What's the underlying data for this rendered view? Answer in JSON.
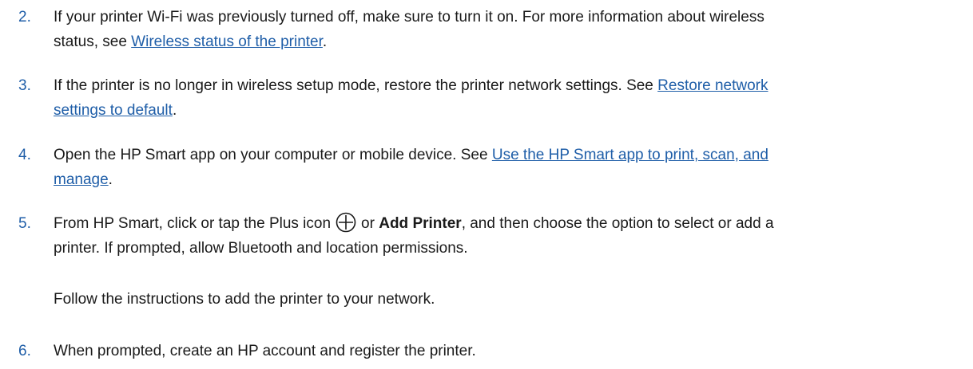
{
  "steps": [
    {
      "number": "2.",
      "line1": "If your printer Wi-Fi was previously turned off, make sure to turn it on. For more information about wireless",
      "line2_prefix": "status, see ",
      "line2_link": "Wireless status of the printer",
      "line2_suffix": "."
    },
    {
      "number": "3.",
      "line1_prefix": "If the printer is no longer in wireless setup mode, restore the printer network settings. See ",
      "line1_link": "Restore network",
      "line2_link": "settings to default",
      "line2_suffix": "."
    },
    {
      "number": "4.",
      "line1_prefix": "Open the HP Smart app on your computer or mobile device. See ",
      "line1_link": "Use the HP Smart app to print, scan, and",
      "line2_link": "manage",
      "line2_suffix": "."
    },
    {
      "number": "5.",
      "line1_prefix": "From HP Smart, click or tap the Plus icon",
      "line1_mid": "or ",
      "line1_bold": "Add Printer",
      "line1_suffix": ", and then choose the option to select or add a",
      "line2": "printer. If prompted, allow Bluetooth and location permissions.",
      "note": "Follow the instructions to add the printer to your network.",
      "icon": "plus-circle-icon"
    },
    {
      "number": "6.",
      "line1": "When prompted, create an HP account and register the printer."
    }
  ],
  "colors": {
    "accent": "#1f5ea8",
    "text": "#1a1a1a"
  }
}
